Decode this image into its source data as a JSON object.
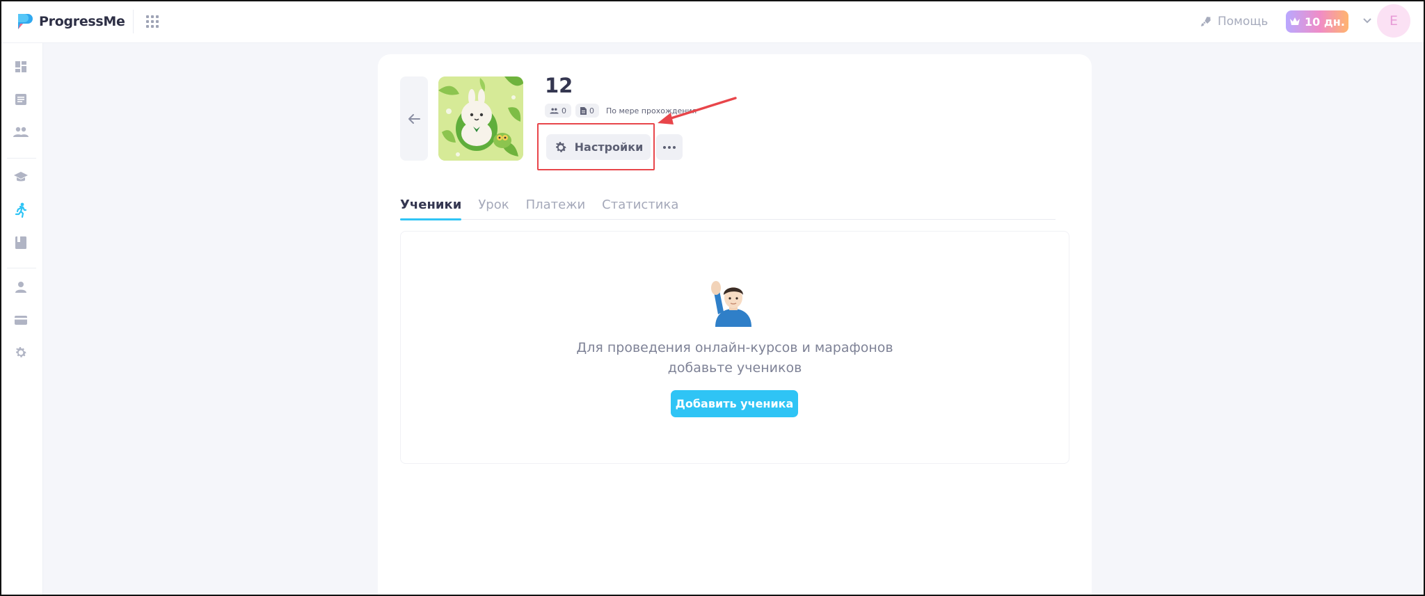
{
  "app": {
    "name": "ProgressMe",
    "help_label": "Помощь",
    "trial_label": "10 дн.",
    "user_initial": "E"
  },
  "sidebar": {
    "items": [
      {
        "name": "dashboard",
        "icon": "dashboard-icon"
      },
      {
        "name": "lessons",
        "icon": "document-list-icon"
      },
      {
        "name": "students",
        "icon": "group-icon"
      },
      {
        "name": "courses",
        "icon": "graduation-cap-icon"
      },
      {
        "name": "marathons",
        "icon": "running-person-icon",
        "active": true
      },
      {
        "name": "library",
        "icon": "book-icon"
      },
      {
        "name": "profile",
        "icon": "person-icon"
      },
      {
        "name": "payments",
        "icon": "card-icon"
      },
      {
        "name": "settings",
        "icon": "gear-icon"
      }
    ]
  },
  "course": {
    "title": "12",
    "students_count": "0",
    "lessons_count": "0",
    "mode": "По мере прохождения",
    "settings_label": "Настройки"
  },
  "tabs": [
    {
      "label": "Ученики",
      "active": true
    },
    {
      "label": "Урок",
      "active": false
    },
    {
      "label": "Платежи",
      "active": false
    },
    {
      "label": "Статистика",
      "active": false
    }
  ],
  "empty_state": {
    "line1": "Для проведения онлайн-курсов и марафонов",
    "line2": "добавьте учеников",
    "button_label": "Добавить ученика"
  },
  "colors": {
    "accent": "#2fc4f5",
    "annotation": "#e8454a",
    "sidebar_active": "#2fc4f5",
    "icon_muted": "#a6abbc"
  }
}
